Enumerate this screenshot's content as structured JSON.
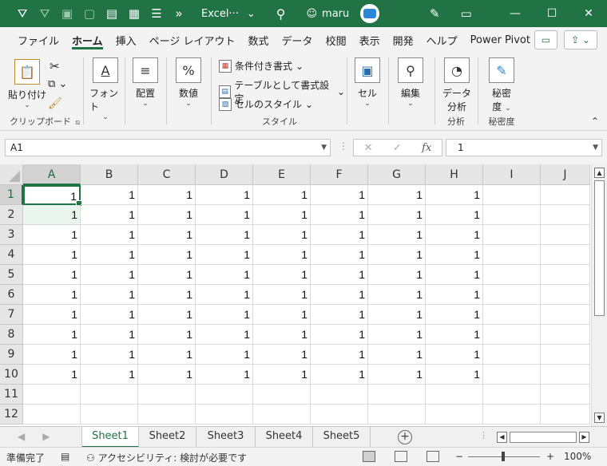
{
  "titlebar": {
    "title": "Excel···",
    "user": "maru",
    "icons": [
      "filter-icon",
      "filter-clear-icon",
      "lock-icon",
      "unlock-icon",
      "doc-icon",
      "grid-icon",
      "form-icon",
      "more-icon"
    ]
  },
  "menu": {
    "tabs": [
      "ファイル",
      "ホーム",
      "挿入",
      "ページ レイアウト",
      "数式",
      "データ",
      "校閲",
      "表示",
      "開発",
      "ヘルプ",
      "Power Pivot"
    ],
    "active": "ホーム"
  },
  "ribbon": {
    "paste": "貼り付け",
    "clipboard_group": "クリップボード",
    "font": "フォント",
    "align": "配置",
    "number": "数値",
    "cond_format": "条件付き書式",
    "table_format": "テーブルとして書式設定",
    "cell_style": "セルのスタイル",
    "style_group": "スタイル",
    "cells": "セル",
    "edit": "編集",
    "data_analysis_1": "データ",
    "data_analysis_2": "分析",
    "analysis_group": "分析",
    "sens_1": "秘密",
    "sens_2": "度",
    "sens_group": "秘密度"
  },
  "formula": {
    "namebox": "A1",
    "value": "1",
    "fx": "fx"
  },
  "grid": {
    "columns": [
      "A",
      "B",
      "C",
      "D",
      "E",
      "F",
      "G",
      "H",
      "I",
      "J"
    ],
    "rows": [
      "1",
      "2",
      "3",
      "4",
      "5",
      "6",
      "7",
      "8",
      "9",
      "10",
      "11",
      "12"
    ],
    "filled_rows": 10,
    "filled_cols": 8,
    "cell_value": "1"
  },
  "sheets": {
    "tabs": [
      "Sheet1",
      "Sheet2",
      "Sheet3",
      "Sheet4",
      "Sheet5"
    ],
    "active": "Sheet1"
  },
  "status": {
    "ready": "準備完了",
    "accessibility": "アクセシビリティ: 検討が必要です",
    "zoom": "100%"
  }
}
